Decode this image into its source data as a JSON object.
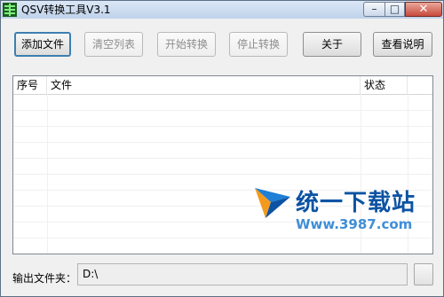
{
  "window": {
    "title": "QSV转换工具V3.1",
    "controls": {
      "minimize": "–",
      "maximize": "□",
      "close": "✕"
    }
  },
  "toolbar": {
    "add_file": "添加文件",
    "clear_list": "清空列表",
    "start_convert": "开始转换",
    "stop_convert": "停止转换",
    "about": "关于",
    "view_help": "查看说明"
  },
  "table": {
    "columns": [
      "序号",
      "文件",
      "状态",
      ""
    ],
    "rows": []
  },
  "watermark": {
    "name": "统一下载站",
    "url": "Www.3987.com"
  },
  "output": {
    "label": "输出文件夹：",
    "path": "D:\\"
  },
  "colors": {
    "accent_border": "#3c7fb1",
    "disabled_text": "#8d8d8d",
    "watermark_blue": "#0c53a3"
  }
}
